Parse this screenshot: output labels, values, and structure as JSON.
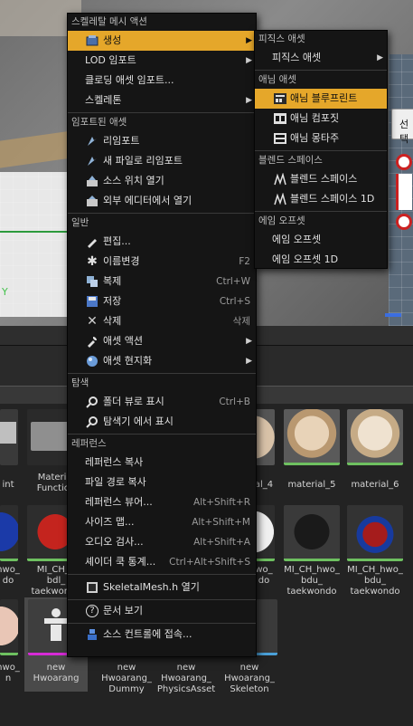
{
  "main_menu": {
    "header": "스켈레탈 메시 액션",
    "items_top": [
      {
        "label": "생성",
        "icon": "create-asset-icon",
        "submenu": true,
        "highlighted": true
      },
      {
        "label": "LOD 임포트",
        "submenu": true
      },
      {
        "label": "클로딩 애셋 임포트..."
      },
      {
        "label": "스켈레톤",
        "submenu": true
      }
    ],
    "import_header": "임포트된 애셋",
    "import_items": [
      {
        "label": "리임포트",
        "icon": "reimport-icon"
      },
      {
        "label": "새 파일로 리임포트",
        "icon": "reimport-new-file-icon"
      },
      {
        "label": "소스 위치 열기",
        "icon": "open-source-location-icon"
      },
      {
        "label": "외부 에디터에서 열기",
        "icon": "open-external-editor-icon"
      }
    ],
    "general_header": "일반",
    "general_items": [
      {
        "label": "편집...",
        "icon": "edit-icon",
        "shortcut": ""
      },
      {
        "label": "이름변경",
        "icon": "rename-icon",
        "shortcut": "F2"
      },
      {
        "label": "복제",
        "icon": "duplicate-icon",
        "shortcut": "Ctrl+W"
      },
      {
        "label": "저장",
        "icon": "save-icon",
        "shortcut": "Ctrl+S"
      },
      {
        "label": "삭제",
        "icon": "delete-icon",
        "shortcut": "삭제"
      },
      {
        "label": "애셋 액션",
        "icon": "asset-actions-icon",
        "submenu": true
      },
      {
        "label": "애셋 현지화",
        "icon": "localization-icon",
        "submenu": true
      }
    ],
    "explore_header": "탐색",
    "explore_items": [
      {
        "label": "폴더 뷰로 표시",
        "icon": "folder-view-icon",
        "shortcut": "Ctrl+B"
      },
      {
        "label": "탐색기 에서 표시",
        "icon": "show-in-explorer-icon",
        "shortcut": ""
      }
    ],
    "reference_header": "레퍼런스",
    "reference_items": [
      {
        "label": "레퍼런스 복사",
        "shortcut": ""
      },
      {
        "label": "파일 경로 복사",
        "shortcut": ""
      },
      {
        "label": "레퍼런스 뷰어...",
        "shortcut": "Alt+Shift+R"
      },
      {
        "label": "사이즈 맵...",
        "shortcut": "Alt+Shift+M"
      },
      {
        "label": "오디오 검사...",
        "shortcut": "Alt+Shift+A"
      },
      {
        "label": "셰이더 쿡 통계...",
        "shortcut": "Ctrl+Alt+Shift+S"
      }
    ],
    "open_header_item": {
      "label": "SkeletalMesh.h 열기",
      "icon": "cpp-header-icon"
    },
    "docs_item": {
      "label": "문서 보기",
      "icon": "help-icon"
    },
    "source_control_item": {
      "label": "소스 컨트롤에 접속...",
      "icon": "source-control-icon"
    }
  },
  "submenu": {
    "physics_header": "피직스 애셋",
    "physics_item": "피직스 애셋",
    "anim_header": "애님 애셋",
    "anim_items": [
      {
        "label": "애님 블루프린트",
        "icon": "anim-blueprint-icon",
        "highlighted": true
      },
      {
        "label": "애님 컴포짓",
        "icon": "anim-composite-icon"
      },
      {
        "label": "애님 몽타주",
        "icon": "anim-montage-icon"
      }
    ],
    "blend_header": "블렌드 스페이스",
    "blend_items": [
      {
        "label": "블렌드 스페이스",
        "icon": "blend-space-icon"
      },
      {
        "label": "블렌드 스페이스 1D",
        "icon": "blend-space-1d-icon"
      }
    ],
    "aim_header": "에임 오프셋",
    "aim_items": [
      {
        "label": "에임 오프셋"
      },
      {
        "label": "에임 오프셋 1D"
      }
    ]
  },
  "viewport": {
    "axis_label": "Y",
    "tooltip_partial": "선택"
  },
  "content_browser": {
    "row1_labels": [
      "int",
      "Material\nFunction",
      "al_4",
      "material_5",
      "material_6"
    ],
    "row2_labels": [
      "hwo_\ndo",
      "MI_CH_h\nbdl_\ntaekwondo",
      "wo_\ndo",
      "MI_CH_hwo_\nbdu_\ntaekwondo",
      "MI_CH_hwo_\nbdu_\ntaekwondo"
    ],
    "row3_labels": [
      "hwo_\nn",
      "new\nHwoarang",
      "new\nHwoarang_\nDummy",
      "new\nHwoarang_\nPhysicsAsset",
      "new\nHwoarang_\nSkeleton"
    ]
  }
}
